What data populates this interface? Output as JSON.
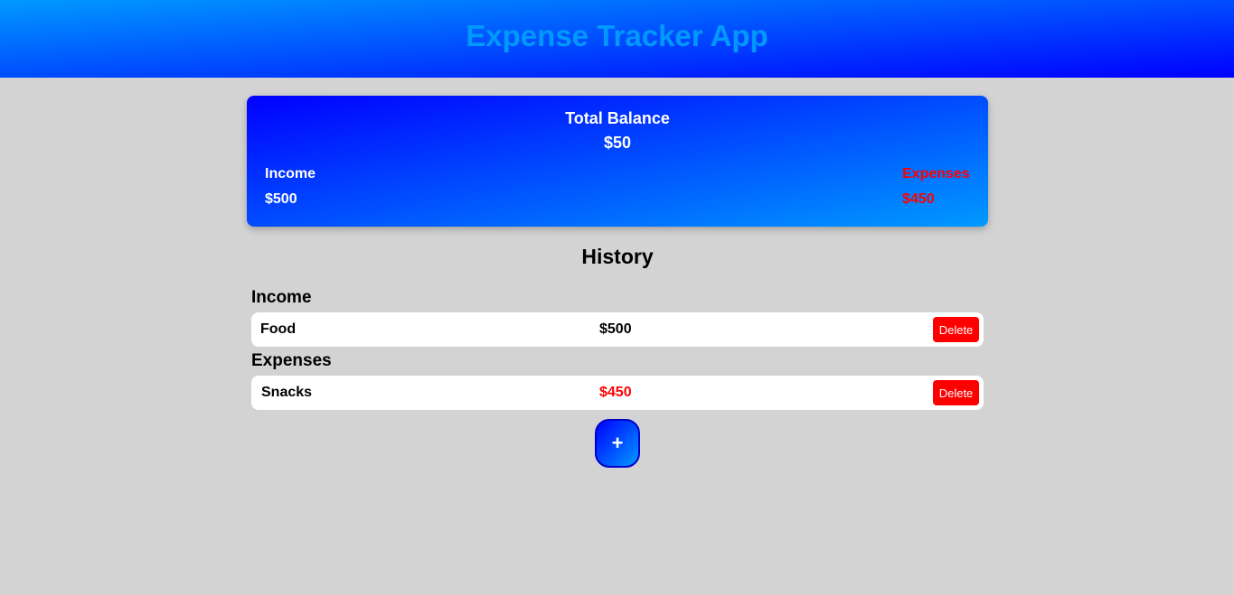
{
  "header": {
    "title": "Expense Tracker App"
  },
  "balance": {
    "label": "Total Balance",
    "value": "$50",
    "income_label": "Income",
    "income_value": "$500",
    "expenses_label": "Expenses",
    "expenses_value": "$450"
  },
  "history": {
    "title": "History",
    "income_section": {
      "title": "Income",
      "items": [
        {
          "name": "Food",
          "amount": "$500",
          "delete_label": "Delete"
        }
      ]
    },
    "expenses_section": {
      "title": "Expenses",
      "items": [
        {
          "name": "Snacks",
          "amount": "$450",
          "delete_label": "Delete"
        }
      ]
    }
  },
  "add_button": {
    "label": "+"
  },
  "colors": {
    "background": "#d3d3d3",
    "header_gradient_start": "#0099ff",
    "header_gradient_end": "#0000ff",
    "title_color": "#0099ff",
    "expense_red": "#ff0000",
    "delete_button": "#ff0000",
    "row_background": "#ffffff"
  }
}
